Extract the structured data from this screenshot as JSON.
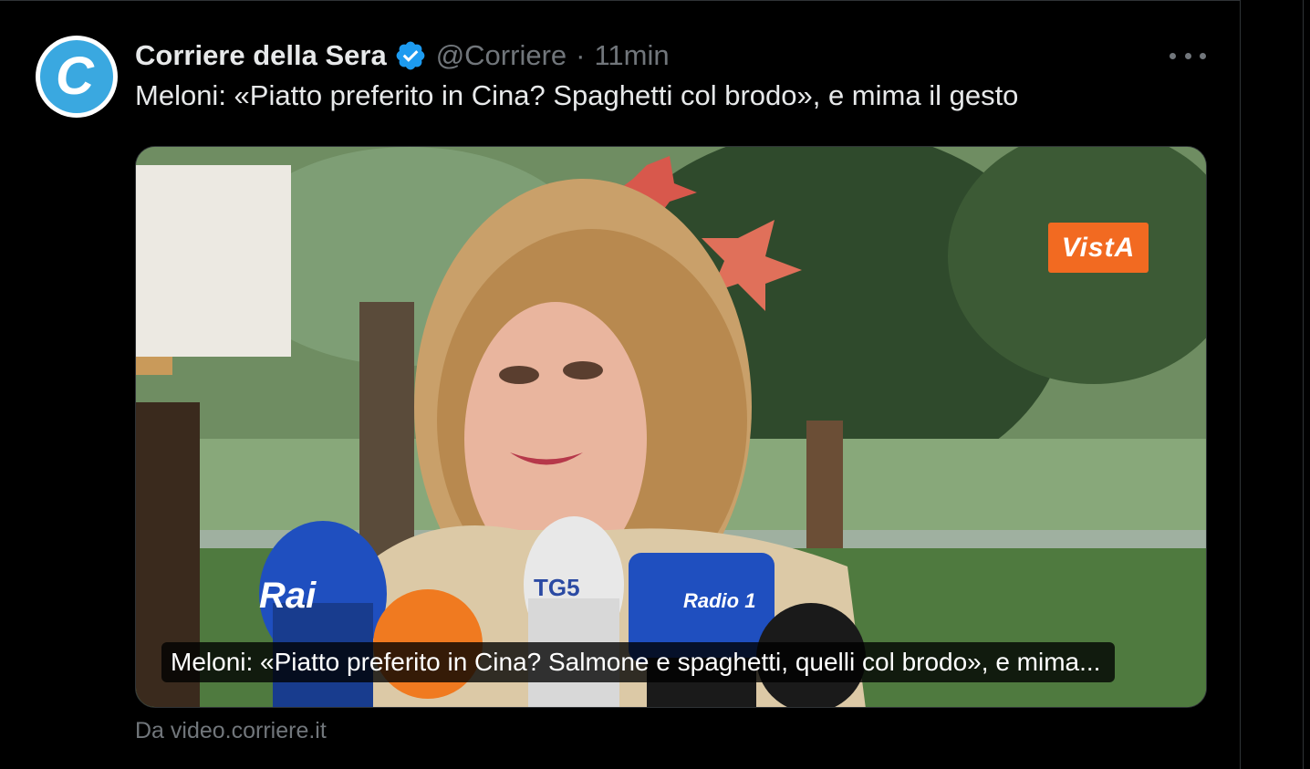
{
  "account": {
    "avatar_letter": "C",
    "name": "Corriere della Sera",
    "handle": "@Corriere",
    "separator": "·",
    "time": "11min",
    "verified": true,
    "verified_color": "#1d9bf0"
  },
  "tweet": {
    "text": "Meloni: «Piatto preferito in Cina? Spaghetti col brodo», e mima il gesto"
  },
  "media": {
    "watermark": "VistA",
    "watermark_color": "#f26a21",
    "mic_labels": [
      "Rai",
      "TG5",
      "Radio 1"
    ],
    "caption": "Meloni: «Piatto preferito in Cina? Salmone e spaghetti, quelli col brodo», e mima..."
  },
  "source": {
    "text": "Da video.corriere.it"
  },
  "icons": {
    "more": "more-horizontal-icon",
    "verified": "verified-badge-icon"
  }
}
